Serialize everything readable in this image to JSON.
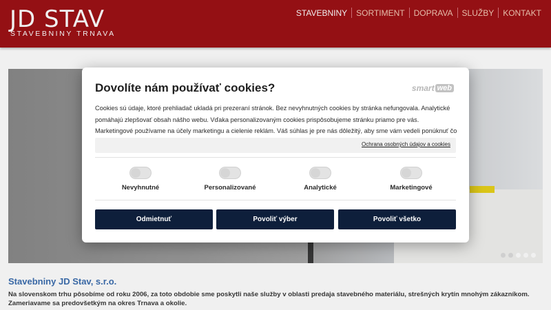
{
  "header": {
    "logo_main": "JD STAV",
    "logo_sub": "STAVEBNINY TRNAVA",
    "nav": [
      "STAVEBNINY",
      "SORTIMENT",
      "DOPRAVA",
      "SLUŽBY",
      "KONTAKT"
    ],
    "active_nav": "STAVEBNINY",
    "brand_color": "#9e1116"
  },
  "hero": {
    "slides_count": 5,
    "active_slide": 1
  },
  "cookie_modal": {
    "title": "Dovolíte nám používať cookies?",
    "brand_text": "smart",
    "brand_box": "web",
    "text": "Cookies sú údaje, ktoré prehliadač ukladá pri prezeraní stránok. Bez nevyhnutných cookies by stránka nefungovala. Analytické pomáhajú zlepšovať obsah nášho webu. Vďaka personalizovaným cookies prispôsobujeme stránku priamo pre vás. Marketingové používame na účely marketingu a cielenie reklám. Váš súhlas je pre nás dôležitý, aby sme vám vedeli ponúknuť čo najlepší obsah.",
    "policy_link": "Ochrana osobných údajov a cookies",
    "toggles": [
      {
        "label": "Nevyhnutné",
        "on": false
      },
      {
        "label": "Personalizované",
        "on": false
      },
      {
        "label": "Analytické",
        "on": false
      },
      {
        "label": "Marketingové",
        "on": false
      }
    ],
    "buttons": {
      "reject": "Odmietnuť",
      "allow_selection": "Povoliť výber",
      "allow_all": "Povoliť všetko"
    },
    "button_color": "#0e1f3b"
  },
  "content": {
    "title": "Stavebniny JD Stav, s.r.o.",
    "text": "Na slovenskom trhu pôsobíme od roku 2006, za toto obdobie sme poskytli naše služby v oblasti predaja stavebného materiálu, strešných krytín mnohým zákazníkom. Zameriavame sa predovšetkým na okres Trnava a okolie.",
    "title_color": "#3d6fb0"
  }
}
